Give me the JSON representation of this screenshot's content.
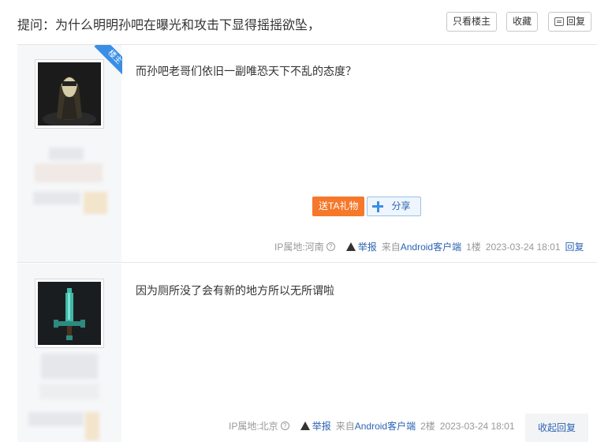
{
  "header": {
    "title": "提问：为什么明明孙吧在曝光和攻击下显得摇摇欲坠，",
    "only_op_label": "只看楼主",
    "favorite_label": "收藏",
    "reply_label": "回复"
  },
  "posts": [
    {
      "badge": "楼主",
      "content": "而孙吧老哥们依旧一副唯恐天下不乱的态度？",
      "gift_label": "送TA礼物",
      "share_label": "分享",
      "ip": "IP属地:河南",
      "report_label": "举报",
      "client": "来自Android客户端",
      "floor": "1楼",
      "time": "2023-03-24 18:01",
      "reply_label": "回复"
    },
    {
      "content": "因为厕所没了会有新的地方所以无所谓啦",
      "ip": "IP属地:北京",
      "report_label": "举报",
      "client": "来自Android客户端",
      "floor": "2楼",
      "time": "2023-03-24 18:01",
      "reply_label": "收起回复"
    }
  ],
  "icons": {
    "help": "help-circle-icon",
    "warning": "warning-icon",
    "share": "share-plus-icon",
    "reply": "reply-icon"
  },
  "colors": {
    "link": "#2d64b3",
    "gift": "#f5782b",
    "badge": "#3a8ee6"
  }
}
